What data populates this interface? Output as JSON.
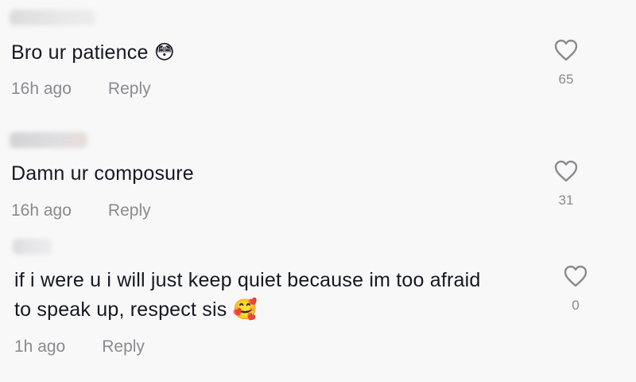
{
  "comments": [
    {
      "text": "Bro ur patience 😳",
      "time": "16h ago",
      "reply_label": "Reply",
      "likes": "65",
      "like_icon": "heart-outline-icon"
    },
    {
      "text": "Damn ur composure",
      "time": "16h ago",
      "reply_label": "Reply",
      "likes": "31",
      "like_icon": "heart-outline-icon"
    },
    {
      "text_line1": "if i were u i will just keep quiet because im too afraid",
      "text_line2": "to speak up, respect sis 🥰",
      "time": "1h ago",
      "reply_label": "Reply",
      "likes": "0",
      "like_icon": "heart-outline-icon"
    }
  ],
  "colors": {
    "background": "#f8f8f8",
    "text": "#161823",
    "secondary_text": "#8a8b91"
  }
}
